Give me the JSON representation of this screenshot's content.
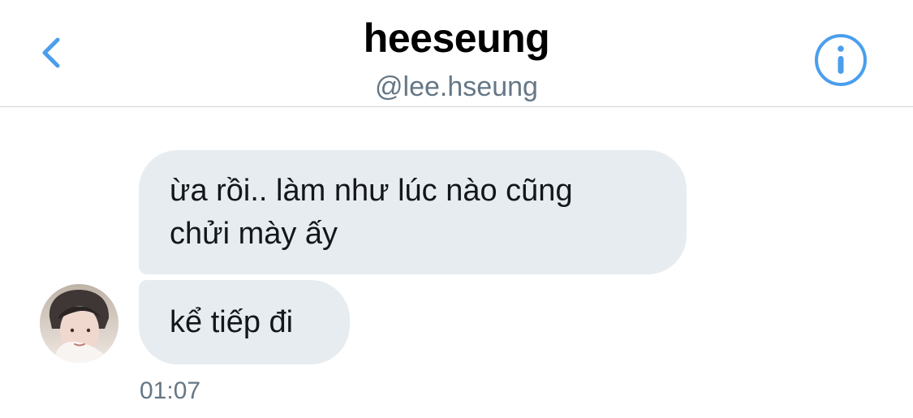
{
  "header": {
    "name": "heeseung",
    "handle": "@lee.hseung",
    "back_icon": "chevron-left-icon",
    "info_icon": "info-icon",
    "accent": "#4a9eed"
  },
  "messages": [
    {
      "lines": [
        "ừa rồi.. làm như lúc nào cũng",
        "chửi mày ấy"
      ],
      "bubble_color": "#e6ecf0"
    },
    {
      "lines": [
        "kể tiếp đi"
      ],
      "bubble_color": "#e6ecf0"
    }
  ],
  "timestamp": "01:07",
  "colors": {
    "text": "#14171a",
    "muted": "#657786",
    "divider": "#d3d6da"
  }
}
